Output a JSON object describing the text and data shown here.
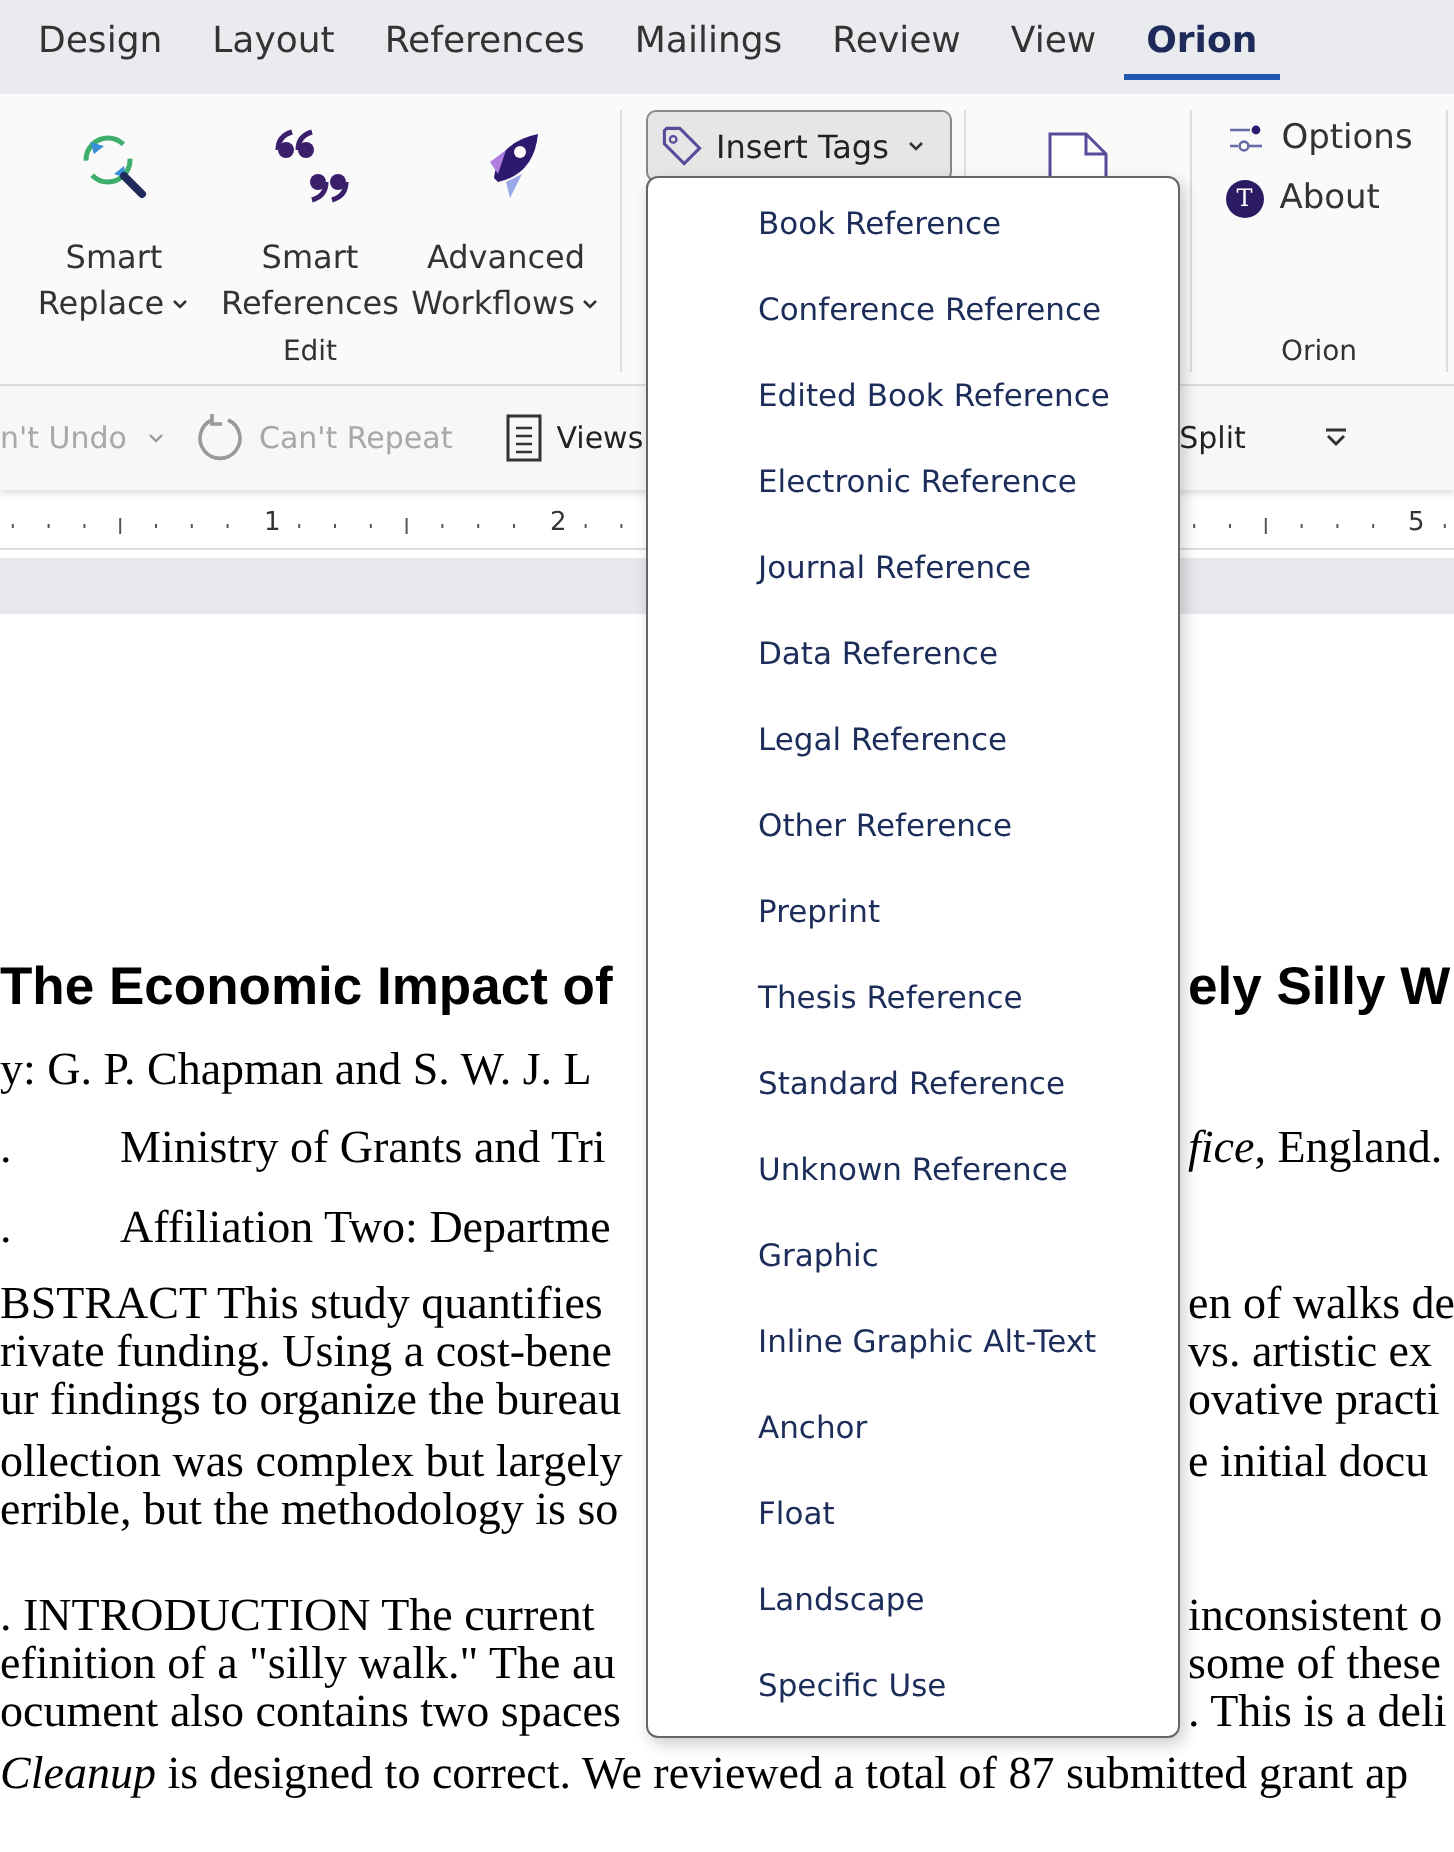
{
  "tabs": [
    {
      "label": "Design",
      "selected": false
    },
    {
      "label": "Layout",
      "selected": false
    },
    {
      "label": "References",
      "selected": false
    },
    {
      "label": "Mailings",
      "selected": false
    },
    {
      "label": "Review",
      "selected": false
    },
    {
      "label": "View",
      "selected": false
    },
    {
      "label": "Orion",
      "selected": true
    }
  ],
  "ribbon": {
    "edit_group": {
      "label": "Edit",
      "buttons": [
        {
          "kind": "replace",
          "line1": "Smart",
          "line2": "Replace",
          "dropdown": true
        },
        {
          "kind": "references",
          "line1": "Smart",
          "line2": "References",
          "dropdown": false
        },
        {
          "kind": "workflows",
          "line1": "Advanced",
          "line2": "Workflows",
          "dropdown": true
        }
      ]
    },
    "insert_tags": {
      "label": "Insert Tags",
      "expanded": true
    },
    "orion_group": {
      "label": "Orion",
      "items": [
        {
          "kind": "options",
          "label": "Options"
        },
        {
          "kind": "about",
          "label": "About",
          "badge": "T"
        }
      ]
    }
  },
  "quick_toolbar": {
    "undo": {
      "label": "n't Undo",
      "disabled": true
    },
    "repeat": {
      "label": "Can't Repeat",
      "disabled": true
    },
    "views": "Views",
    "split": "Split"
  },
  "ruler": {
    "labels": [
      "1",
      "2",
      "5"
    ]
  },
  "menu": {
    "items": [
      "Book Reference",
      "Conference Reference",
      "Edited Book Reference",
      "Electronic Reference",
      "Journal Reference",
      "Data Reference",
      "Legal Reference",
      "Other Reference",
      "Preprint",
      "Thesis Reference",
      "Standard Reference",
      "Unknown Reference",
      "Graphic",
      "Inline Graphic Alt-Text",
      "Anchor",
      "Float",
      "Landscape",
      "Specific Use"
    ]
  },
  "document": {
    "blocks": [
      {
        "kind": "title",
        "lines": [
          {
            "left": "The Economic Impact of",
            "right": "ely Silly W"
          }
        ]
      },
      {
        "kind": "byline",
        "lines": [
          {
            "left": "y: G. P. Chapman and S. W. J. L"
          }
        ]
      },
      {
        "kind": "affiliation",
        "lines": [
          {
            "num": ".",
            "left": "Ministry of Grants and Tri",
            "right": "*fice*, England."
          }
        ]
      },
      {
        "kind": "affiliation",
        "lines": [
          {
            "num": ".",
            "left": "Affiliation Two: Departme"
          }
        ]
      },
      {
        "kind": "paragraph",
        "lines": [
          {
            "left": "BSTRACT This study quantifies",
            "right": "en of walks de"
          },
          {
            "left": "rivate funding. Using a cost-bene",
            "right": "vs. artistic ex"
          },
          {
            "left": "ur findings to organize the bureau",
            "right": "ovative practi"
          },
          {
            "left": "ollection was complex but largely",
            "right": "e initial docu"
          },
          {
            "left": "errible, but the methodology is so"
          }
        ]
      },
      {
        "kind": "paragraph",
        "lines": [
          {
            "left": ". INTRODUCTION The current",
            "right": "inconsistent o"
          },
          {
            "left": "efinition of a \"silly walk.\" The au",
            "right": "some of these"
          },
          {
            "left": "ocument also contains two spaces",
            "right": ". This is a deli"
          },
          {
            "left": "*Cleanup* is designed to correct. We reviewed a total of 87 submitted grant ap"
          }
        ]
      }
    ]
  }
}
